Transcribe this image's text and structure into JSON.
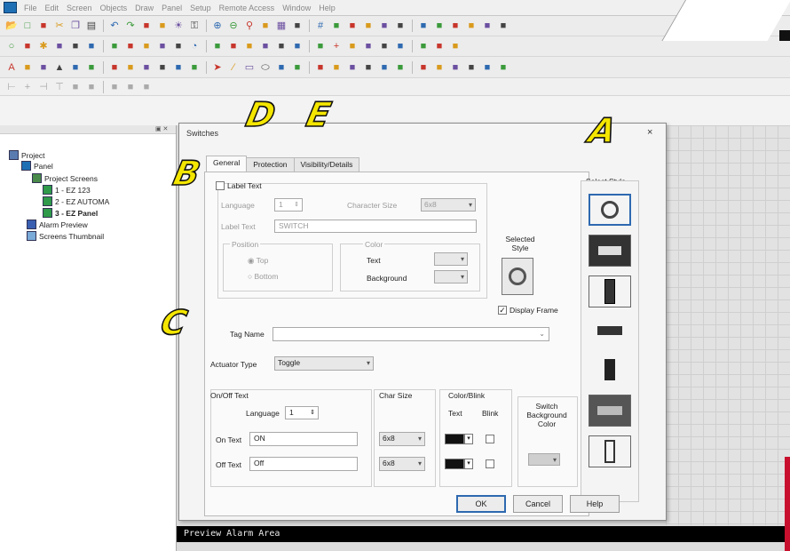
{
  "menu": [
    "File",
    "Edit",
    "Screen",
    "Objects",
    "Draw",
    "Panel",
    "Setup",
    "Remote Access",
    "Window",
    "Help"
  ],
  "toolbars": {
    "row1": [
      "open-icon",
      "new-icon",
      "save-icon",
      "cut-icon",
      "copy-icon",
      "paste-icon",
      "undo-icon",
      "redo-icon",
      "screen-icon",
      "camera-icon",
      "light-icon",
      "key-icon",
      "zoom-in-icon",
      "zoom-out-icon",
      "zoom-icon",
      "zoom-fit-icon",
      "grid-icon",
      "layout-icon",
      "hash-icon",
      "tag-icon",
      "square-icon",
      "chart-icon",
      "list-icon",
      "database-icon",
      "arrow-left-icon",
      "arrow-right-icon",
      "flag-icon",
      "copy-screen-icon",
      "paste-screen-icon",
      "tree-icon"
    ],
    "row2": [
      "circle-icon",
      "light-bulb-icon",
      "star-icon",
      "thermometer-icon",
      "trend-icon",
      "tm-icon",
      "meter-icon",
      "bar-icon",
      "keypad-icon",
      "lamp-icon",
      "frame-icon",
      "clock-icon",
      "gauge-icon",
      "arc-icon",
      "bar-chart-icon",
      "line-chart-icon",
      "mixed-chart-icon",
      "alarm-icon",
      "pie-icon",
      "plus-icon",
      "u-icon",
      "c-icon",
      "wave-icon",
      "cross-icon",
      "red-icon",
      "record-icon",
      "box-icon"
    ],
    "row3": [
      "text-a-icon",
      "text-numeric-icon",
      "text-ascii-icon",
      "triangle-icon",
      "numeric-37-icon",
      "recipe-icon",
      "graphic-icon",
      "image-icon",
      "date-icon",
      "message-icon",
      "timer-icon",
      "picture-icon",
      "pointer-icon",
      "pen-icon",
      "rectangle-icon",
      "ellipse-icon",
      "color-icon",
      "tilde-icon",
      "align-icon",
      "align2-icon",
      "align3-icon",
      "align4-icon",
      "rotate-icon",
      "flip-icon",
      "transform-icon",
      "curve-icon",
      "polygon-icon",
      "stack-icon",
      "fill-icon",
      "settings-icon"
    ],
    "row4": [
      "align-left-icon",
      "align-center-icon",
      "align-right-icon",
      "align-top-icon",
      "align-middle-icon",
      "align-bottom-icon",
      "group-icon",
      "ungroup-icon",
      "order-icon"
    ]
  },
  "annotations": {
    "A": "A",
    "B": "B",
    "C": "C",
    "D": "D",
    "E": "E"
  },
  "tree": {
    "root": "Project",
    "panel": "Panel",
    "project_screens": "Project Screens",
    "screens": [
      "1 - EZ 123",
      "2 - EZ AUTOMA",
      "3 - EZ Panel"
    ],
    "alarm_preview": "Alarm Preview",
    "thumbnails": "Screens Thumbnail"
  },
  "canvas": {
    "preview_label": "Preview Alarm Area"
  },
  "dialog": {
    "title": "Switches",
    "close": "×",
    "tabs": [
      "General",
      "Protection",
      "Visibility/Details"
    ],
    "label_text_check": "Label Text",
    "language_label": "Language",
    "language_value": "1",
    "char_size_label": "Character Size",
    "char_size_value": "6x8",
    "label_text_label": "Label Text",
    "label_text_value": "SWITCH",
    "position_label": "Position",
    "pos_top": "Top",
    "pos_bottom": "Bottom",
    "color_label": "Color",
    "text_label": "Text",
    "background_label": "Background",
    "selected_style_label": "Selected Style",
    "display_frame": "Display Frame",
    "tag_name_label": "Tag Name",
    "tag_name_value": "",
    "actuator_type_label": "Actuator Type",
    "actuator_type_value": "Toggle",
    "onoff_text_label": "On/Off Text",
    "onoff_language_label": "Language",
    "onoff_language_value": "1",
    "char_size2_label": "Char Size",
    "color_blink_label": "Color/Blink",
    "text_col_label": "Text",
    "blink_label": "Blink",
    "switch_bg_label": "Switch Background Color",
    "on_text_label": "On Text",
    "on_text_value": "ON",
    "off_text_label": "Off Text",
    "off_text_value": "Off",
    "on_char_size": "6x8",
    "off_char_size": "6x8",
    "select_style_label": "Select Style",
    "ok": "OK",
    "cancel": "Cancel",
    "help": "Help"
  },
  "colors": {
    "accent": "#2e69b0",
    "annotation": "#f4e600",
    "preview_bg": "#000000"
  }
}
